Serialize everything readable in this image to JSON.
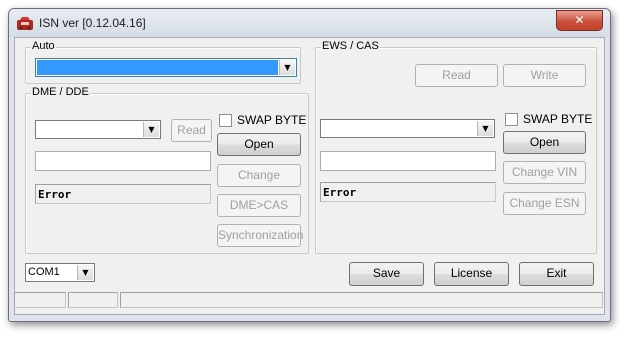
{
  "window": {
    "title": "ISN ver [0.12.04.16]",
    "close_glyph": "✕",
    "icon": "app-car-icon"
  },
  "auto": {
    "legend": "Auto",
    "selected_value": ""
  },
  "dme": {
    "legend": "DME / DDE",
    "device_value": "",
    "read_label": "Read",
    "swap_label": "SWAP BYTE",
    "swap_checked": false,
    "open_label": "Open",
    "text_value": "",
    "status_text": "Error",
    "change_label": "Change",
    "dme_cas_label": "DME>CAS",
    "sync_label": "Synchronization"
  },
  "ews": {
    "legend": "EWS / CAS",
    "read_label": "Read",
    "write_label": "Write",
    "swap_label": "SWAP BYTE",
    "swap_checked": false,
    "device_value": "",
    "open_label": "Open",
    "text_value": "",
    "status_text": "Error",
    "change_vin_label": "Change VIN",
    "change_esn_label": "Change ESN"
  },
  "footer": {
    "port_value": "COM1",
    "save_label": "Save",
    "license_label": "License",
    "exit_label": "Exit"
  },
  "statusbar": {
    "cells": [
      "",
      "",
      ""
    ]
  },
  "colors": {
    "selection": "#3399ff",
    "close_button": "#c9503b"
  }
}
